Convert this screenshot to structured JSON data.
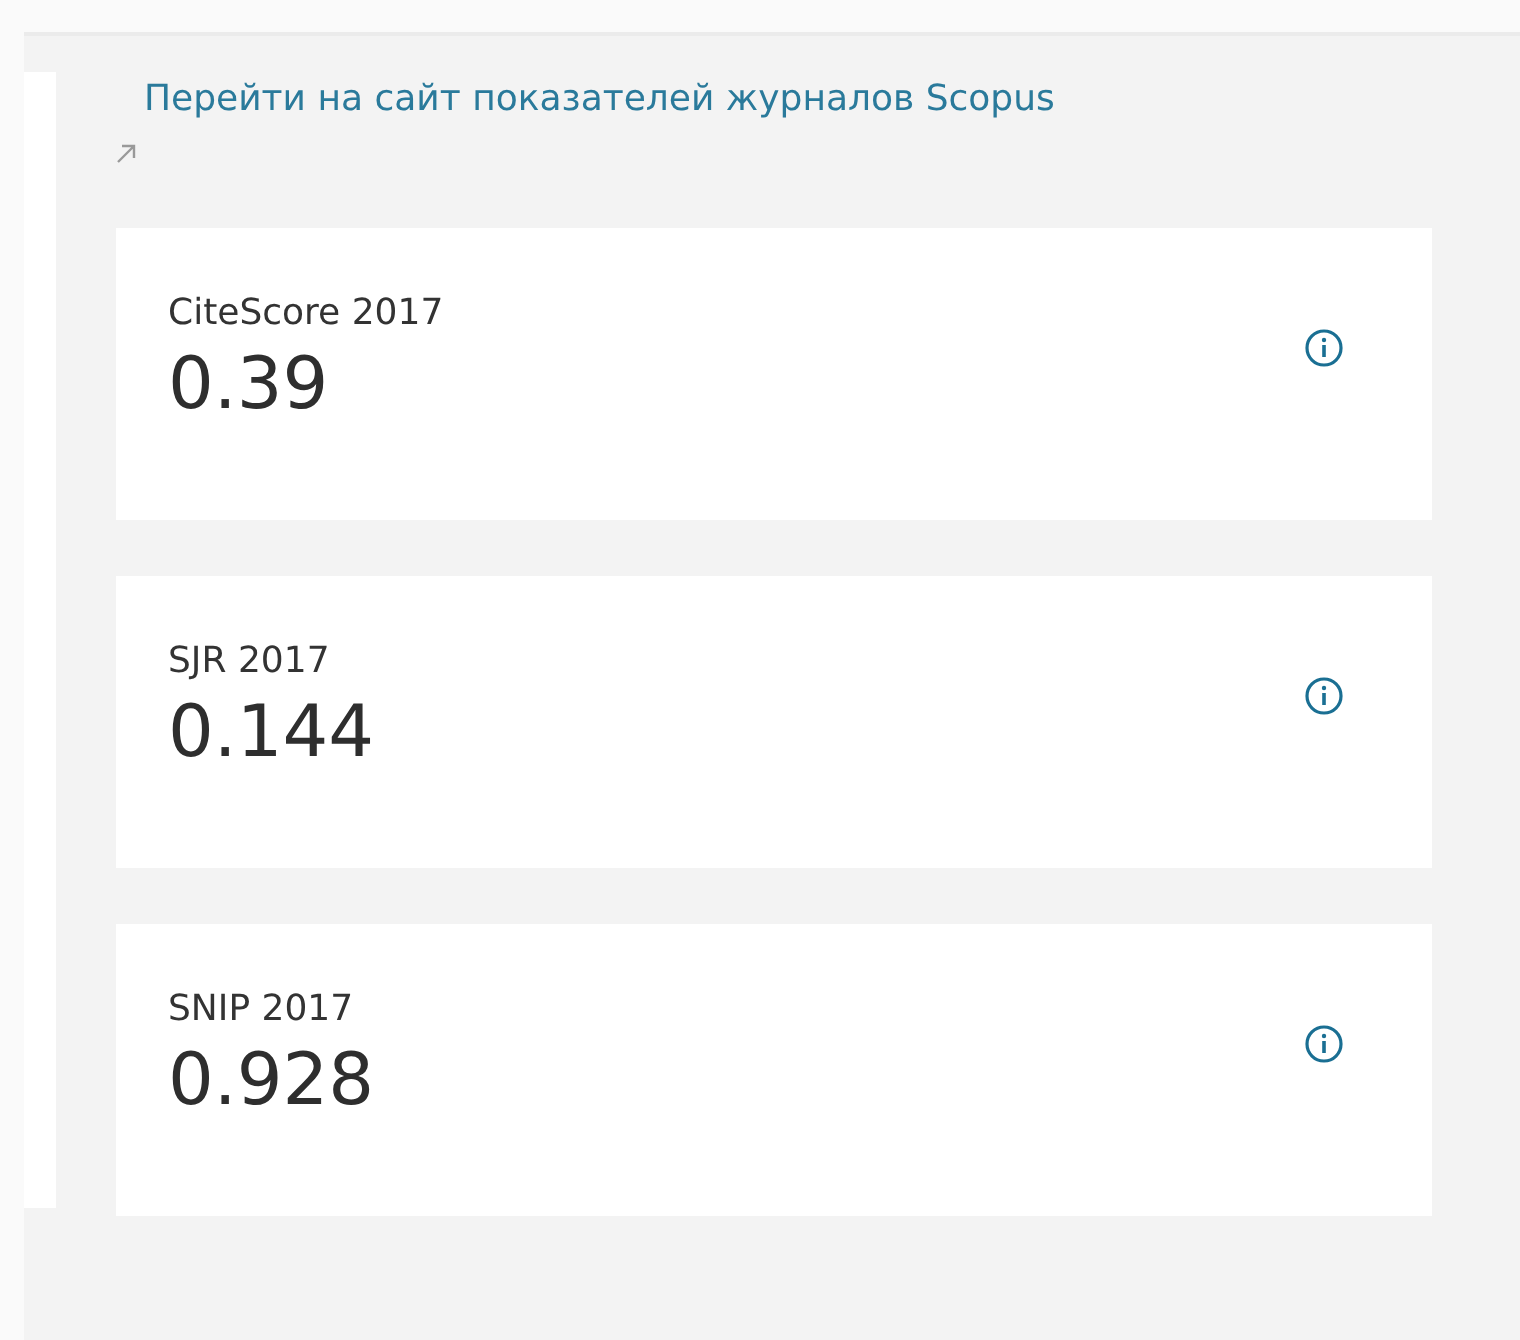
{
  "link": {
    "label": "Перейти на сайт показателей журналов Scopus"
  },
  "metrics": [
    {
      "label": "CiteScore 2017",
      "value": "0.39"
    },
    {
      "label": "SJR 2017",
      "value": "0.144"
    },
    {
      "label": "SNIP 2017",
      "value": "0.928"
    }
  ]
}
